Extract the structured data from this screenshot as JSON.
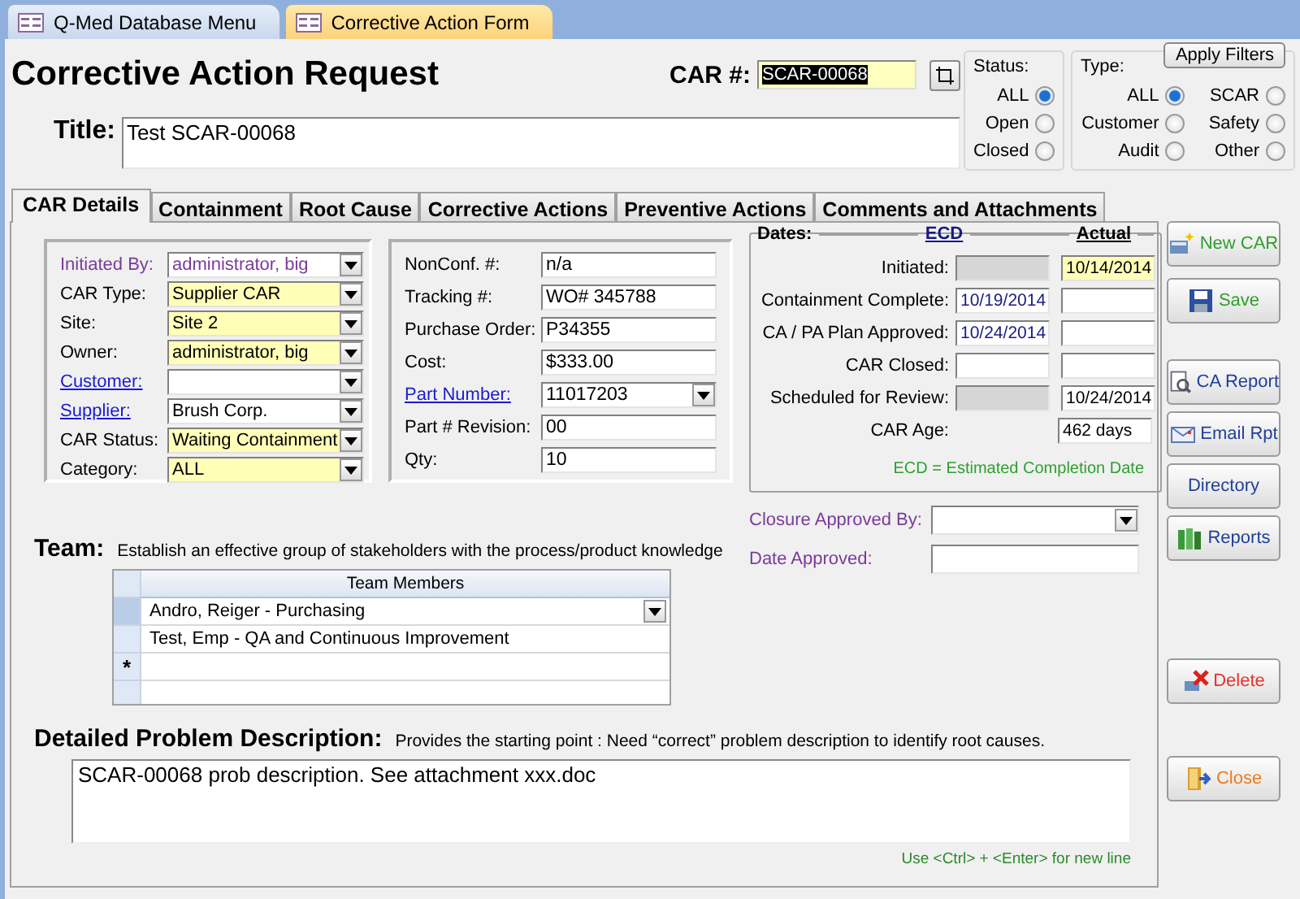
{
  "document_tabs": [
    {
      "label": "Q-Med Database Menu",
      "selected": false
    },
    {
      "label": "Corrective Action Form",
      "selected": true
    }
  ],
  "header": {
    "title": "Corrective Action Request",
    "car_number": {
      "label": "CAR #:",
      "value": "SCAR-00068"
    }
  },
  "filters": {
    "apply_label": "Apply Filters",
    "status": {
      "label": "Status:",
      "options": [
        {
          "label": "ALL",
          "selected": true
        },
        {
          "label": "Open",
          "selected": false
        },
        {
          "label": "Closed",
          "selected": false
        }
      ]
    },
    "type": {
      "label": "Type:",
      "options": [
        {
          "label": "ALL",
          "selected": true
        },
        {
          "label": "SCAR",
          "selected": false
        },
        {
          "label": "Customer",
          "selected": false
        },
        {
          "label": "Safety",
          "selected": false
        },
        {
          "label": "Audit",
          "selected": false
        },
        {
          "label": "Other",
          "selected": false
        }
      ]
    }
  },
  "title_field": {
    "label": "Title:",
    "value": "Test SCAR-00068"
  },
  "tabs": [
    {
      "label": "CAR Details",
      "selected": true
    },
    {
      "label": "Containment",
      "selected": false
    },
    {
      "label": "Root Cause",
      "selected": false
    },
    {
      "label": "Corrective Actions",
      "selected": false
    },
    {
      "label": "Preventive Actions",
      "selected": false
    },
    {
      "label": "Comments and Attachments",
      "selected": false
    }
  ],
  "details": [
    {
      "label": "Initiated By:",
      "value": "administrator, big",
      "kind": "system",
      "required": false
    },
    {
      "label": "CAR Type:",
      "value": "Supplier CAR",
      "kind": "plain",
      "required": true
    },
    {
      "label": "Site:",
      "value": "Site 2",
      "kind": "plain",
      "required": true
    },
    {
      "label": "Owner:",
      "value": "administrator, big",
      "kind": "plain",
      "required": true
    },
    {
      "label": "Customer:",
      "kind": "link",
      "required": false
    },
    {
      "label": "Supplier:",
      "value": "Brush Corp.",
      "kind": "link",
      "required": false
    },
    {
      "label": "CAR Status:",
      "value": "Waiting Containment",
      "kind": "plain",
      "required": true
    },
    {
      "label": "Category:",
      "value": "ALL",
      "kind": "plain",
      "required": true
    }
  ],
  "tracking": [
    {
      "label": "NonConf. #:",
      "value": "n/a",
      "kind": "plain",
      "dropdown": false
    },
    {
      "label": "Tracking #:",
      "value": "WO# 345788",
      "kind": "plain",
      "dropdown": false
    },
    {
      "label": "Purchase Order:",
      "value": "P34355",
      "kind": "plain",
      "dropdown": false
    },
    {
      "label": "Cost:",
      "value": "$333.00",
      "kind": "plain",
      "dropdown": false
    },
    {
      "label": "Part Number:",
      "value": "11017203",
      "kind": "link",
      "dropdown": true
    },
    {
      "label": "Part # Revision:",
      "value": "00",
      "kind": "plain",
      "dropdown": false
    },
    {
      "label": "Qty:",
      "value": "10",
      "kind": "plain",
      "dropdown": false
    }
  ],
  "dates": {
    "legend": "Dates:",
    "ecd_heading": "ECD",
    "actual_heading": "Actual",
    "rows": [
      {
        "label": "Initiated:",
        "ecd": {
          "disabled": true
        },
        "actual": {
          "value": "10/14/2014",
          "required": true
        }
      },
      {
        "label": "Containment Complete:",
        "ecd": {
          "value": "10/19/2014",
          "disabled": false
        },
        "actual": {
          "required": false
        }
      },
      {
        "label": "CA / PA Plan Approved:",
        "ecd": {
          "value": "10/24/2014",
          "disabled": false
        },
        "actual": {
          "required": false
        }
      },
      {
        "label": "CAR Closed:",
        "ecd": {
          "disabled": false
        },
        "actual": {
          "required": false
        }
      },
      {
        "label": "Scheduled for Review:",
        "ecd": {
          "disabled": true
        },
        "actual": {
          "value": "10/24/2014",
          "required": false
        }
      },
      {
        "label": "CAR Age:",
        "actual": {
          "value": "462 days",
          "required": false
        }
      }
    ],
    "note": "ECD = Estimated Completion Date"
  },
  "closure": [
    {
      "label": "Closure Approved By:",
      "dropdown": true
    },
    {
      "label": "Date Approved:",
      "dropdown": false
    }
  ],
  "team": {
    "label": "Team:",
    "hint": "Establish an effective group of stakeholders with the process/product knowledge",
    "column": "Team Members",
    "new_row_marker": "*",
    "rows": [
      {
        "value": "Andro, Reiger  - Purchasing",
        "current": true
      },
      {
        "value": "Test, Emp  - QA and Continuous Improvement",
        "current": false
      }
    ]
  },
  "problem": {
    "label": "Detailed Problem Description:",
    "hint": "Provides the starting point : Need “correct” problem description to identify root causes.",
    "value": "SCAR-00068 prob description.  See attachment xxx.doc",
    "note": "Use <Ctrl> + <Enter> for new line"
  },
  "action_groups": [
    [
      {
        "label": "New CAR",
        "kind": "new",
        "color": "#2e9e2e"
      },
      {
        "label": "Save",
        "kind": "save",
        "color": "#2e9e2e"
      }
    ],
    [
      {
        "label": "CA Report",
        "kind": "report",
        "color": "#1f3f9a"
      },
      {
        "label": "Email Rpt",
        "kind": "email",
        "color": "#1f3f9a"
      },
      {
        "label": "Directory",
        "kind": "plain",
        "color": "#1f3f9a"
      },
      {
        "label": "Reports",
        "kind": "books",
        "color": "#1f3f9a"
      }
    ],
    [
      {
        "label": "Delete",
        "kind": "delete",
        "color": "#e8302a"
      }
    ],
    [
      {
        "label": "Close",
        "kind": "close",
        "color": "#f07a1a"
      }
    ]
  ]
}
